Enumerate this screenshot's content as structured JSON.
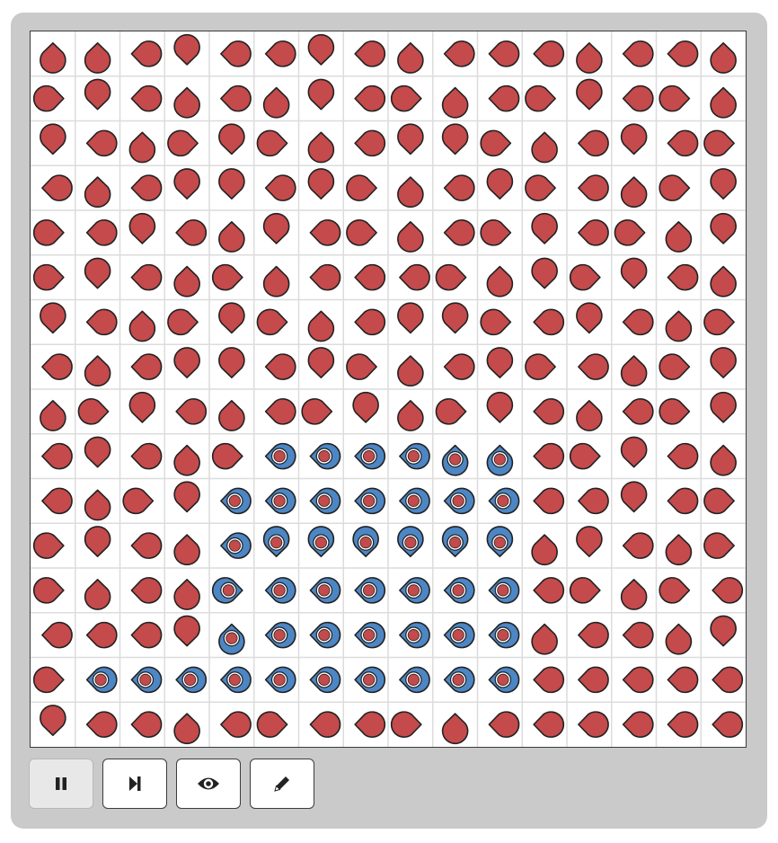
{
  "grid": {
    "rows": 16,
    "cols": 16,
    "colors": {
      "red_fill": "#c44a4b",
      "blue_fill": "#4d86c4",
      "outline": "#222222",
      "grid_line": "#dcdcdc"
    },
    "directions": [
      "uuldlldlulllullu",
      "rdluludlrulrdlru",
      "dlurdrulddruldlr",
      "lulddldruldrlurd",
      "rldludlrulrdlrud",
      "rdlurulllrudrdlu",
      "dlurdrulddrldlur",
      "lulddldruldrlurd",
      "urdlulrdurdlulrd",
      "ldlurlllluulrdlu",
      "lurdllllllllldlr",
      "rdlulddddddudlur",
      "rulurlllllllrurl",
      "llldullllllullud",
      "rlllllllllllllll",
      "dllulrllrullllll"
    ],
    "blue_cells": [
      [
        9,
        5
      ],
      [
        9,
        6
      ],
      [
        9,
        7
      ],
      [
        9,
        8
      ],
      [
        9,
        9
      ],
      [
        9,
        10
      ],
      [
        10,
        4
      ],
      [
        10,
        5
      ],
      [
        10,
        6
      ],
      [
        10,
        7
      ],
      [
        10,
        8
      ],
      [
        10,
        9
      ],
      [
        10,
        10
      ],
      [
        11,
        4
      ],
      [
        11,
        5
      ],
      [
        11,
        6
      ],
      [
        11,
        7
      ],
      [
        11,
        8
      ],
      [
        11,
        9
      ],
      [
        11,
        10
      ],
      [
        12,
        4
      ],
      [
        12,
        5
      ],
      [
        12,
        6
      ],
      [
        12,
        7
      ],
      [
        12,
        8
      ],
      [
        12,
        9
      ],
      [
        12,
        10
      ],
      [
        13,
        4
      ],
      [
        13,
        5
      ],
      [
        13,
        6
      ],
      [
        13,
        7
      ],
      [
        13,
        8
      ],
      [
        13,
        9
      ],
      [
        13,
        10
      ],
      [
        14,
        1
      ],
      [
        14,
        2
      ],
      [
        14,
        3
      ],
      [
        14,
        4
      ],
      [
        14,
        5
      ],
      [
        14,
        6
      ],
      [
        14,
        7
      ],
      [
        14,
        8
      ],
      [
        14,
        9
      ],
      [
        14,
        10
      ]
    ]
  },
  "controls": {
    "pause": {
      "icon": "pause-icon",
      "pressed": true
    },
    "step": {
      "icon": "step-forward-icon",
      "pressed": false
    },
    "view": {
      "icon": "eye-icon",
      "pressed": false
    },
    "edit": {
      "icon": "pencil-icon",
      "pressed": false
    }
  }
}
